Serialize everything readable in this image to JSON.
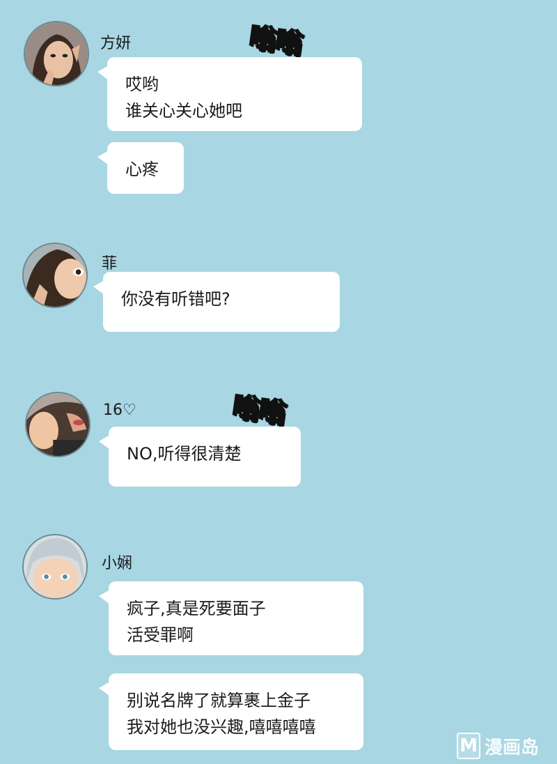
{
  "messages": [
    {
      "sender": "方妍",
      "lines": [
        "哎哟",
        "谁关心关心她吧"
      ]
    },
    {
      "sender": "方妍",
      "lines": [
        "心疼"
      ]
    },
    {
      "sender": "菲",
      "lines": [
        "你没有听错吧?"
      ]
    },
    {
      "sender": "16♡",
      "lines": [
        "NO,听得很清楚"
      ]
    },
    {
      "sender": "小娴",
      "lines": [
        "疯子,真是死要面子",
        "活受罪啊"
      ]
    },
    {
      "sender": "小娴",
      "lines": [
        "别说名牌了就算裹上金子",
        "我对她也没兴趣,嘻嘻嘻嘻"
      ]
    }
  ],
  "sound_effects": [
    "嗡嗡",
    "嗡嗡"
  ],
  "watermark": {
    "logo": "M",
    "text": "漫画岛"
  },
  "colors": {
    "background": "#a8d6e3",
    "bubble": "#ffffff"
  },
  "icons": [
    "avatar-fangyan",
    "avatar-fei",
    "avatar-16",
    "avatar-xiaoxian"
  ]
}
